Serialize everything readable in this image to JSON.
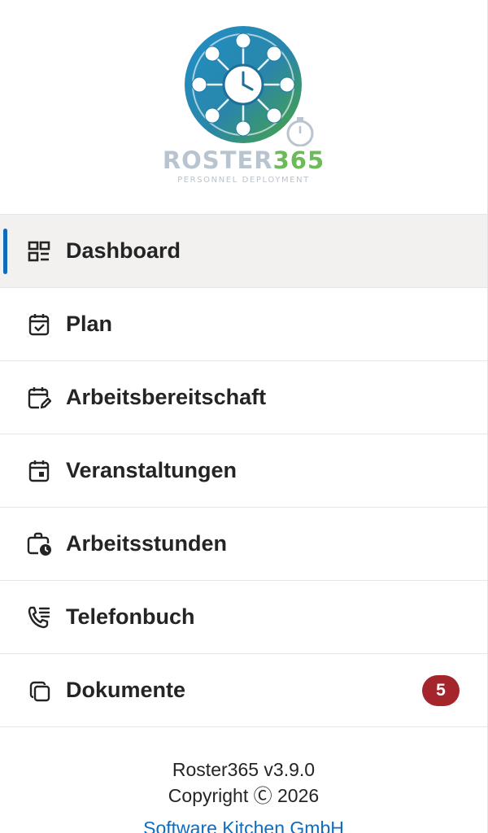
{
  "logo": {
    "name_part1": "ROSTER",
    "name_part2": "365",
    "tagline": "PERSONNEL DEPLOYMENT",
    "colors": {
      "blue": "#1f77b4",
      "green": "#5aa843",
      "gray": "#b8c4d0"
    }
  },
  "nav": {
    "accent": "#0f6cbd",
    "items": [
      {
        "label": "Dashboard",
        "icon": "dashboard-icon",
        "active": true
      },
      {
        "label": "Plan",
        "icon": "calendar-check-icon"
      },
      {
        "label": "Arbeitsbereitschaft",
        "icon": "calendar-edit-icon"
      },
      {
        "label": "Veranstaltungen",
        "icon": "calendar-event-icon"
      },
      {
        "label": "Arbeitsstunden",
        "icon": "briefcase-clock-icon"
      },
      {
        "label": "Telefonbuch",
        "icon": "phone-list-icon"
      },
      {
        "label": "Dokumente",
        "icon": "documents-icon",
        "badge": "5"
      }
    ]
  },
  "badge_color": "#a4262c",
  "footer": {
    "version": "Roster365 v3.9.0",
    "copyright": "Copyright Ⓒ 2026",
    "company": "Software Kitchen GmbH"
  }
}
